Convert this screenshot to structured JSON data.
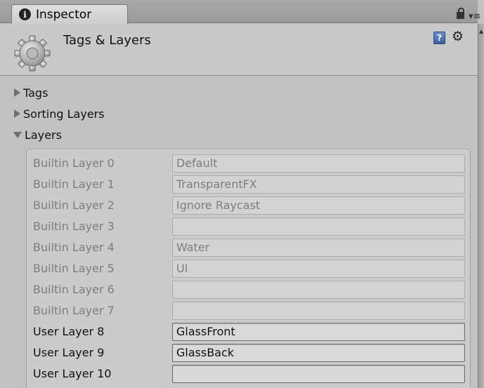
{
  "tab": {
    "label": "Inspector",
    "info_glyph": "i"
  },
  "header": {
    "title": "Tags & Layers",
    "help_glyph": "?"
  },
  "foldouts": [
    {
      "label": "Tags",
      "expanded": false
    },
    {
      "label": "Sorting Layers",
      "expanded": false
    },
    {
      "label": "Layers",
      "expanded": true
    }
  ],
  "layers": [
    {
      "label": "Builtin Layer 0",
      "value": "Default",
      "editable": false
    },
    {
      "label": "Builtin Layer 1",
      "value": "TransparentFX",
      "editable": false
    },
    {
      "label": "Builtin Layer 2",
      "value": "Ignore Raycast",
      "editable": false
    },
    {
      "label": "Builtin Layer 3",
      "value": "",
      "editable": false
    },
    {
      "label": "Builtin Layer 4",
      "value": "Water",
      "editable": false
    },
    {
      "label": "Builtin Layer 5",
      "value": "UI",
      "editable": false
    },
    {
      "label": "Builtin Layer 6",
      "value": "",
      "editable": false
    },
    {
      "label": "Builtin Layer 7",
      "value": "",
      "editable": false
    },
    {
      "label": "User Layer 8",
      "value": "GlassFront",
      "editable": true
    },
    {
      "label": "User Layer 9",
      "value": "GlassBack",
      "editable": true
    },
    {
      "label": "User Layer 10",
      "value": "",
      "editable": true
    }
  ],
  "icons": {
    "tab": "info-icon",
    "lock": "lock-icon",
    "menu": "tab-menu-icon",
    "component": "gear-icon",
    "help": "help-icon",
    "settings": "settings-gear-icon"
  }
}
